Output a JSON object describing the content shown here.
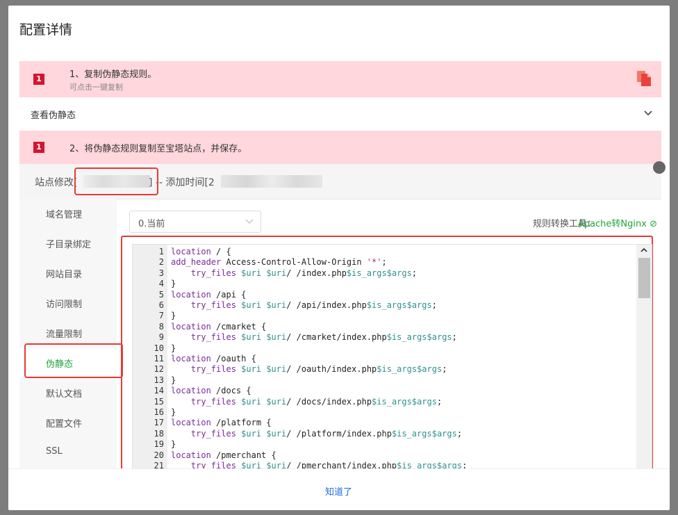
{
  "dialog": {
    "title": "配置详情",
    "ok_label": "知道了"
  },
  "steps": [
    {
      "badge": "1",
      "title": "1、复制伪静态规则。",
      "sub": "可点击一键复制"
    },
    {
      "badge": "1",
      "title": "2、将伪静态规则复制至宝塔站点，并保存。"
    }
  ],
  "accordion": {
    "label": "查看伪静态"
  },
  "site": {
    "header_prefix": "站点修改[",
    "header_mid": "] -- 添加时间[2"
  },
  "nav": [
    {
      "label": "域名管理"
    },
    {
      "label": "子目录绑定"
    },
    {
      "label": "网站目录"
    },
    {
      "label": "访问限制"
    },
    {
      "label": "流量限制"
    },
    {
      "label": "伪静态",
      "active": true
    },
    {
      "label": "默认文档"
    },
    {
      "label": "配置文件"
    },
    {
      "label": "SSL"
    }
  ],
  "select": {
    "value": "0.当前"
  },
  "tool": {
    "label": "规则转换工具：",
    "link": "Apache转Nginx"
  },
  "code_lines": [
    "location / {",
    "add_header Access-Control-Allow-Origin '*';",
    "    try_files $uri $uri/ /index.php$is_args$args;",
    "}",
    "location /api {",
    "    try_files $uri $uri/ /api/index.php$is_args$args;",
    "}",
    "location /cmarket {",
    "    try_files $uri $uri/ /cmarket/index.php$is_args$args;",
    "}",
    "location /oauth {",
    "    try_files $uri $uri/ /oauth/index.php$is_args$args;",
    "}",
    "location /docs {",
    "    try_files $uri $uri/ /docs/index.php$is_args$args;",
    "}",
    "location /platform {",
    "    try_files $uri $uri/ /platform/index.php$is_args$args;",
    "}",
    "location /pmerchant {",
    "    try_files $uri $uri/ /pmerchant/index.php$is_args$args;"
  ],
  "colors": {
    "accent": "#20a53a",
    "alert_bg": "#ffd7dc",
    "badge": "#d5152f",
    "highlight": "#e83a33",
    "link": "#1e6ed8"
  }
}
